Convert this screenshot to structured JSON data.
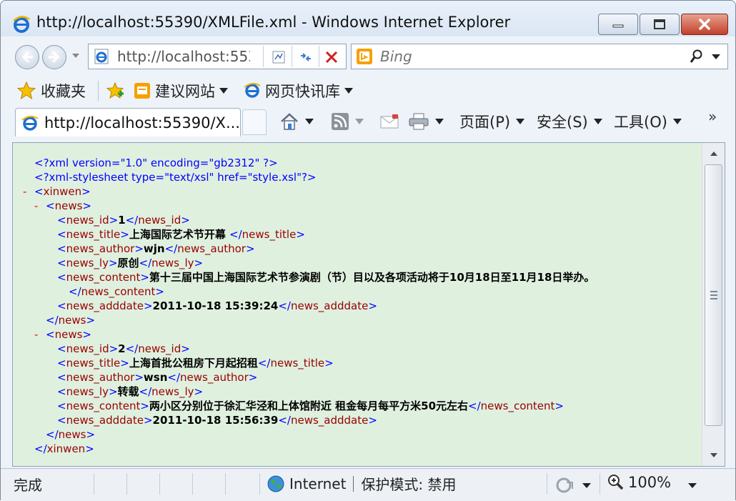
{
  "window": {
    "title": "http://localhost:55390/XMLFile.xml - Windows Internet Explorer"
  },
  "address_bar": {
    "url": "http://localhost:55390/XMLFile.xml"
  },
  "search": {
    "placeholder": "Bing"
  },
  "favorites_bar": {
    "favorites_label": "收藏夹",
    "items": [
      {
        "label": "建议网站",
        "icon": "suggested-sites-icon"
      },
      {
        "label": "网页快讯库",
        "icon": "web-slice-icon"
      }
    ]
  },
  "tabs": [
    {
      "label": "http://localhost:55390/X..."
    }
  ],
  "command_bar": {
    "page_label": "页面(P)",
    "safety_label": "安全(S)",
    "tools_label": "工具(O)",
    "overflow_label": "»"
  },
  "xml_view": {
    "lines": [
      {
        "indent": 0,
        "kind": "pi",
        "text": "<?xml version=\"1.0\" encoding=\"gb2312\" ?>"
      },
      {
        "indent": 0,
        "kind": "pi",
        "text": "<?xml-stylesheet type=\"text/xsl\" href=\"style.xsl\"?>"
      },
      {
        "indent": 0,
        "kind": "open",
        "collapsible": true,
        "tag": "xinwen"
      },
      {
        "indent": 1,
        "kind": "open",
        "collapsible": true,
        "tag": "news"
      },
      {
        "indent": 2,
        "kind": "elem",
        "tag": "news_id",
        "value": "1"
      },
      {
        "indent": 2,
        "kind": "elem",
        "tag": "news_title",
        "value": "上海国际艺术节开幕 "
      },
      {
        "indent": 2,
        "kind": "elem",
        "tag": "news_author",
        "value": "wjn"
      },
      {
        "indent": 2,
        "kind": "elem",
        "tag": "news_ly",
        "value": "原创"
      },
      {
        "indent": 2,
        "kind": "openval",
        "tag": "news_content",
        "value": "第十三届中国上海国际艺术节参演剧（节）目以及各项活动将于10月18日至11月18日举办。"
      },
      {
        "indent": 3,
        "kind": "close",
        "tag": "news_content"
      },
      {
        "indent": 2,
        "kind": "elem",
        "tag": "news_adddate",
        "value": "2011-10-18 15:39:24"
      },
      {
        "indent": 1,
        "kind": "close",
        "tag": "news"
      },
      {
        "indent": 1,
        "kind": "open",
        "collapsible": true,
        "tag": "news"
      },
      {
        "indent": 2,
        "kind": "elem",
        "tag": "news_id",
        "value": "2"
      },
      {
        "indent": 2,
        "kind": "elem",
        "tag": "news_title",
        "value": "上海首批公租房下月起招租"
      },
      {
        "indent": 2,
        "kind": "elem",
        "tag": "news_author",
        "value": "wsn"
      },
      {
        "indent": 2,
        "kind": "elem",
        "tag": "news_ly",
        "value": "转载"
      },
      {
        "indent": 2,
        "kind": "elem",
        "tag": "news_content",
        "value": "两小区分别位于徐汇华泾和上体馆附近 租金每月每平方米50元左右"
      },
      {
        "indent": 2,
        "kind": "elem",
        "tag": "news_adddate",
        "value": "2011-10-18 15:56:39"
      },
      {
        "indent": 1,
        "kind": "close",
        "tag": "news"
      },
      {
        "indent": 0,
        "kind": "close",
        "tag": "xinwen"
      }
    ],
    "collapse_symbol": "-"
  },
  "status_bar": {
    "status": "完成",
    "zone": "Internet",
    "protected_mode": "保护模式: 禁用",
    "zoom": "100%"
  }
}
